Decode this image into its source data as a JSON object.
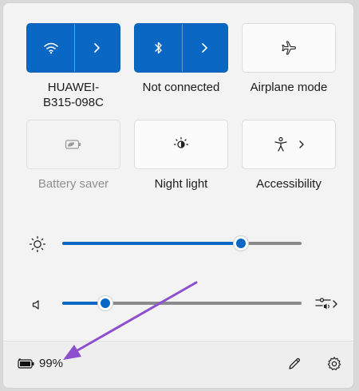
{
  "colors": {
    "accent": "#0a67c3",
    "annotation_arrow": "#8e4fcf"
  },
  "tiles": [
    {
      "id": "wifi",
      "label": "HUAWEI-\nB315-098C",
      "label_lines": [
        "HUAWEI-",
        "B315-098C"
      ],
      "icon": "wifi-icon",
      "state": "on",
      "has_chevron": true
    },
    {
      "id": "bluetooth",
      "label": "Not connected",
      "icon": "bluetooth-icon",
      "state": "on",
      "has_chevron": true
    },
    {
      "id": "airplane",
      "label": "Airplane mode",
      "icon": "airplane-icon",
      "state": "off",
      "has_chevron": false
    },
    {
      "id": "battery-saver",
      "label": "Battery saver",
      "icon": "battery-saver-icon",
      "state": "disabled",
      "has_chevron": false
    },
    {
      "id": "night-light",
      "label": "Night light",
      "icon": "night-light-icon",
      "state": "off",
      "has_chevron": false
    },
    {
      "id": "accessibility",
      "label": "Accessibility",
      "icon": "accessibility-icon",
      "state": "off",
      "has_chevron": true
    }
  ],
  "sliders": {
    "brightness": {
      "icon": "brightness-icon",
      "value_fraction": 0.745
    },
    "volume": {
      "icon": "speaker-icon",
      "value_fraction": 0.18,
      "end_icon": "sound-output-icon"
    }
  },
  "footer": {
    "battery_icon": "battery-charging-icon",
    "battery_percent": "99%",
    "edit_icon": "pencil-icon",
    "settings_icon": "gear-icon"
  }
}
